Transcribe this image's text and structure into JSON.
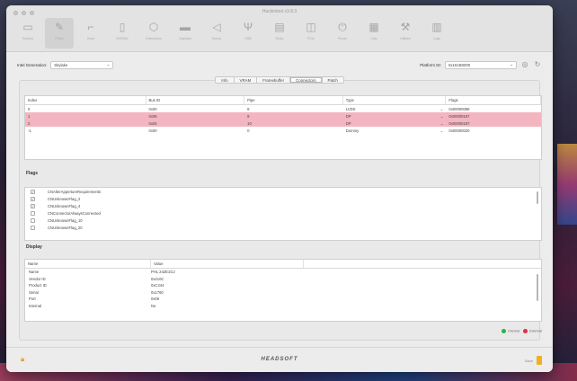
{
  "window": {
    "title": "Hackintool v3.8.3"
  },
  "toolbar": {
    "items": [
      {
        "label": "System",
        "icon": "computer-icon",
        "glyph": "▭"
      },
      {
        "label": "Patch",
        "icon": "brush-icon",
        "glyph": "✎"
      },
      {
        "label": "Boot",
        "icon": "boot-icon",
        "glyph": "⌐"
      },
      {
        "label": "NVRAM",
        "icon": "memory-icon",
        "glyph": "▯"
      },
      {
        "label": "Extensions",
        "icon": "puzzle-icon",
        "glyph": "⬡"
      },
      {
        "label": "Displays",
        "icon": "display-icon",
        "glyph": "▬"
      },
      {
        "label": "Sound",
        "icon": "speaker-icon",
        "glyph": "◁"
      },
      {
        "label": "USB",
        "icon": "usb-icon",
        "glyph": "Ψ"
      },
      {
        "label": "Disks",
        "icon": "disk-icon",
        "glyph": "▤"
      },
      {
        "label": "PCIe",
        "icon": "pcie-icon",
        "glyph": "◫"
      },
      {
        "label": "Power",
        "icon": "power-icon",
        "glyph": "⏻"
      },
      {
        "label": "Calc",
        "icon": "calculator-icon",
        "glyph": "▦"
      },
      {
        "label": "Utilities",
        "icon": "wrench-icon",
        "glyph": "⚒"
      },
      {
        "label": "Logs",
        "icon": "logs-icon",
        "glyph": "▥"
      }
    ]
  },
  "intel_generation": {
    "label": "Intel Generation:",
    "value": "Skylake"
  },
  "platform_id": {
    "label": "Platform ID:",
    "value": "0x191B0000"
  },
  "tabs": [
    "Info",
    "VRAM",
    "Framebuffer",
    "Connectors",
    "Patch"
  ],
  "connectors": {
    "headers": [
      "Index",
      "Bus ID",
      "Pipe",
      "Type",
      "Flags"
    ],
    "rows": [
      {
        "index": "0",
        "bus": "0x00",
        "pipe": "8",
        "type": "LVDS",
        "flags": "0x00000098",
        "selected": false
      },
      {
        "index": "1",
        "bus": "0x05",
        "pipe": "9",
        "type": "DP",
        "flags": "0x00000187",
        "selected": true
      },
      {
        "index": "2",
        "bus": "0x04",
        "pipe": "10",
        "type": "DP",
        "flags": "0x00000187",
        "selected": true
      },
      {
        "index": "-1",
        "bus": "0x00",
        "pipe": "0",
        "type": "Dummy",
        "flags": "0x00000020",
        "selected": false
      }
    ]
  },
  "flags": {
    "title": "Flags",
    "items": [
      {
        "label": "CNAlterAppertureRequirements",
        "checked": true
      },
      {
        "label": "CNUnknownFlag_2",
        "checked": true
      },
      {
        "label": "CNUnknownFlag_4",
        "checked": true
      },
      {
        "label": "CNConnectorAlwaysConnected",
        "checked": false
      },
      {
        "label": "CNUnknownFlag_10",
        "checked": false
      },
      {
        "label": "CNUnknownFlag_20",
        "checked": false
      }
    ]
  },
  "display": {
    "title": "Display",
    "headers": [
      "Name",
      "Value"
    ],
    "rows": [
      {
        "name": "Name",
        "value": "PHL 242E1GJ"
      },
      {
        "name": "Vendor ID",
        "value": "0x410C"
      },
      {
        "name": "Product ID",
        "value": "0xC244"
      },
      {
        "name": "Serial",
        "value": "0x1760"
      },
      {
        "name": "Port",
        "value": "0x06"
      },
      {
        "name": "Internal",
        "value": "No"
      }
    ]
  },
  "legend": {
    "internal": "Internal",
    "external": "External",
    "internal_color": "#2bb24c",
    "external_color": "#e03040"
  },
  "footer": {
    "logo": "HEADSOFT",
    "save": "Save"
  }
}
